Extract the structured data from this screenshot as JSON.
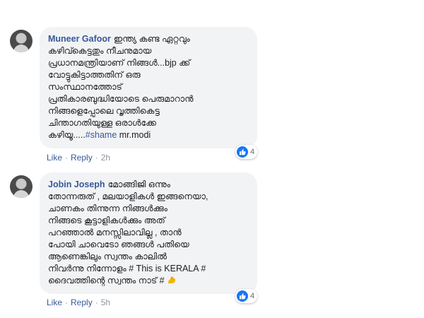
{
  "comments": [
    {
      "author": "Muneer Gafoor",
      "avatar_icon": "user-avatar",
      "lines": [
        "ഇന്ത്യ കണ്ട ഏറ്റവും",
        "കഴിവ്കെട്ടതും നീചനുമായ",
        "പ്രധാനമന്ത്രിയാണ് നിങ്ങൾ...bjp ക്ക്",
        "വോട്ടുകിട്ടാത്തതിന് ഒരു",
        "സംസ്ഥാനത്തോട്",
        "പ്രതികാരബുദ്ധിയോടെ പെരുമാറാൻ",
        "നിങ്ങളെപ്പോലെ വൃത്തികെട്ട",
        "ചിന്താഗതിയുള്ള ഒരാൾക്കേ"
      ],
      "last_line_prefix": "കഴിയൂ.....",
      "hashtag": "#shame",
      "last_line_suffix": " mr.modi",
      "reaction_icon": "like-icon",
      "reaction_count": "4",
      "actions": {
        "like": "Like",
        "separator": "·",
        "reply": "Reply",
        "time": "2h"
      }
    },
    {
      "author": "Jobin Joseph",
      "avatar_icon": "user-avatar",
      "lines": [
        "മോങ്ങിജി ഒന്നും",
        "തോന്നരുത് , മലയാളികൾ ഇങ്ങനെയാ,",
        "ചാണകം തിന്നുന്ന നിങ്ങൾക്കും",
        "നിങ്ങടെ കൂട്ടാളികൾക്കും അത്",
        "പറഞ്ഞാൽ മനസ്സിലാവില്ല , താൻ",
        "പോയി ചാവെടോ ഞങ്ങൾ പതിയെ",
        "ആണെങ്കിലും സ്വന്തം കാലിൽ",
        "നിവർന്നു നിന്നോളം # This is KERALA #"
      ],
      "last_line_prefix": "ദൈവത്തിന്റെ സ്വന്തം നാട് #",
      "emoji_icon": "flexed-biceps-icon",
      "reaction_icon": "like-icon",
      "reaction_count": "4",
      "actions": {
        "like": "Like",
        "separator": "·",
        "reply": "Reply",
        "time": "5h"
      }
    }
  ],
  "colors": {
    "link": "#385898",
    "bubble": "#f2f3f5",
    "like_blue": "#1877f2",
    "muted": "#90949c"
  }
}
